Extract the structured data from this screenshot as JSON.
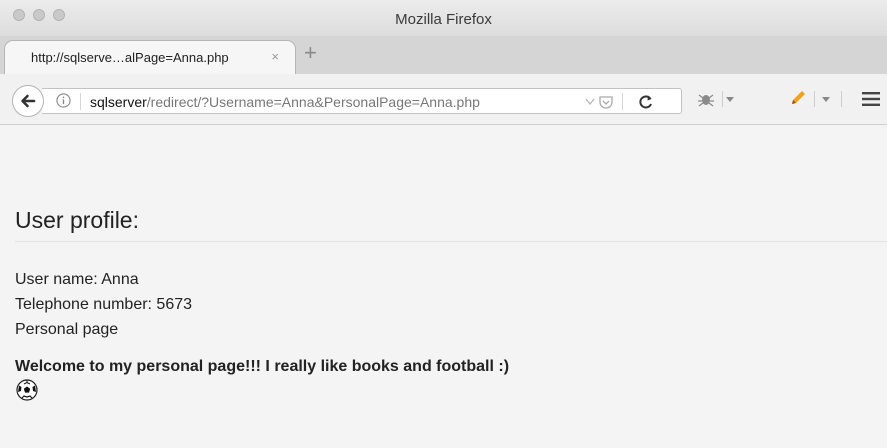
{
  "window": {
    "title": "Mozilla Firefox"
  },
  "tab": {
    "title": "http://sqlserve…alPage=Anna.php",
    "close": "×",
    "new_tab": "+"
  },
  "urlbar": {
    "host": "sqlserver",
    "path": "/redirect/?Username=Anna&PersonalPage=Anna.php"
  },
  "page": {
    "heading": "User profile:",
    "username": "User name: Anna",
    "telephone": "Telephone number: 5673",
    "personal_page": "Personal page",
    "welcome": "Welcome to my personal page!!! I really like books and football :)"
  },
  "icons": {
    "window_controls": [
      "close-button-icon",
      "minimize-button-icon",
      "zoom-button-icon"
    ],
    "nav": [
      "back-arrow-icon",
      "info-icon",
      "dropdown-icon",
      "pocket-icon",
      "reload-icon",
      "bug-icon",
      "pencil-icon",
      "hamburger-menu-icon"
    ],
    "content": [
      "football-icon"
    ]
  },
  "colors": {
    "page_background": "#f4f4f4",
    "tab_background": "#f6f6f6",
    "pencil": "#f2a11d"
  }
}
